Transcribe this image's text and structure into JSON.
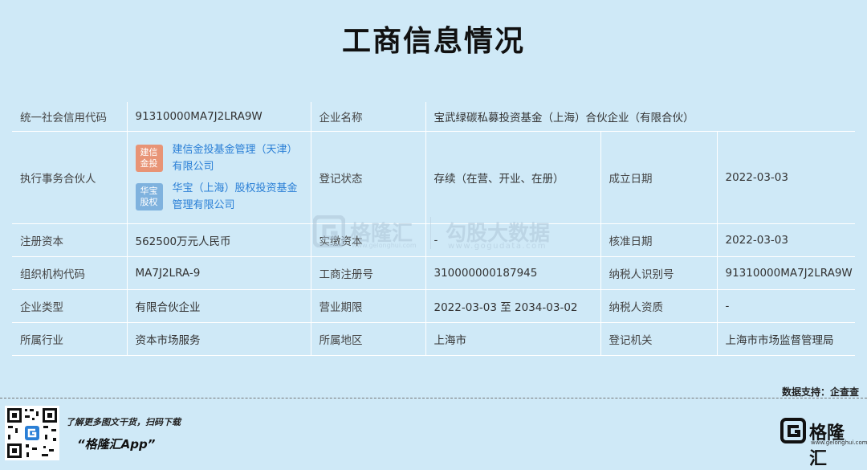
{
  "page": {
    "title": "工商信息情况"
  },
  "table": {
    "row1": {
      "credit_code_label": "统一社会信用代码",
      "credit_code_value": "91310000MA7J2LRA9W",
      "company_name_label": "企业名称",
      "company_name_value": "宝武绿碳私募投资基金（上海）合伙企业（有限合伙）"
    },
    "row2": {
      "partner_label": "执行事务合伙人",
      "partners": [
        {
          "badge": "建信金投",
          "name": "建信金投基金管理（天津）有限公司"
        },
        {
          "badge": "华宝股权",
          "name": "华宝（上海）股权投资基金管理有限公司"
        }
      ],
      "status_label": "登记状态",
      "status_value": "存续（在营、开业、在册）",
      "founded_label": "成立日期",
      "founded_value": "2022-03-03"
    },
    "row3": {
      "capital_label": "注册资本",
      "capital_value": "562500万元人民币",
      "paid_label": "实缴资本",
      "paid_value": "-",
      "approval_label": "核准日期",
      "approval_value": "2022-03-03"
    },
    "row4": {
      "org_code_label": "组织机构代码",
      "org_code_value": "MA7J2LRA-9",
      "reg_no_label": "工商注册号",
      "reg_no_value": "310000000187945",
      "tax_id_label": "纳税人识别号",
      "tax_id_value": "91310000MA7J2LRA9W"
    },
    "row5": {
      "type_label": "企业类型",
      "type_value": "有限合伙企业",
      "term_label": "营业期限",
      "term_value": "2022-03-03 至 2034-03-02",
      "taxpayer_label": "纳税人资质",
      "taxpayer_value": "-"
    },
    "row6": {
      "industry_label": "所属行业",
      "industry_value": "资本市场服务",
      "region_label": "所属地区",
      "region_value": "上海市",
      "authority_label": "登记机关",
      "authority_value": "上海市市场监督管理局"
    }
  },
  "watermark": {
    "brand1": "格隆汇",
    "brand1_url": "www.gelonghui.com",
    "brand2": "勾股大数据",
    "brand2_url": "www.gogudata.com"
  },
  "footer": {
    "source": "数据支持：企查查",
    "promo_line1": "了解更多图文干货，扫码下载",
    "promo_line2": "“格隆汇App”",
    "brand_name": "格隆汇",
    "brand_url": "www.gelonghui.com"
  },
  "colors": {
    "background": "#cfe9f7",
    "link": "#2a7fd6",
    "badge1": "#e89476",
    "badge2": "#7fb2de"
  }
}
